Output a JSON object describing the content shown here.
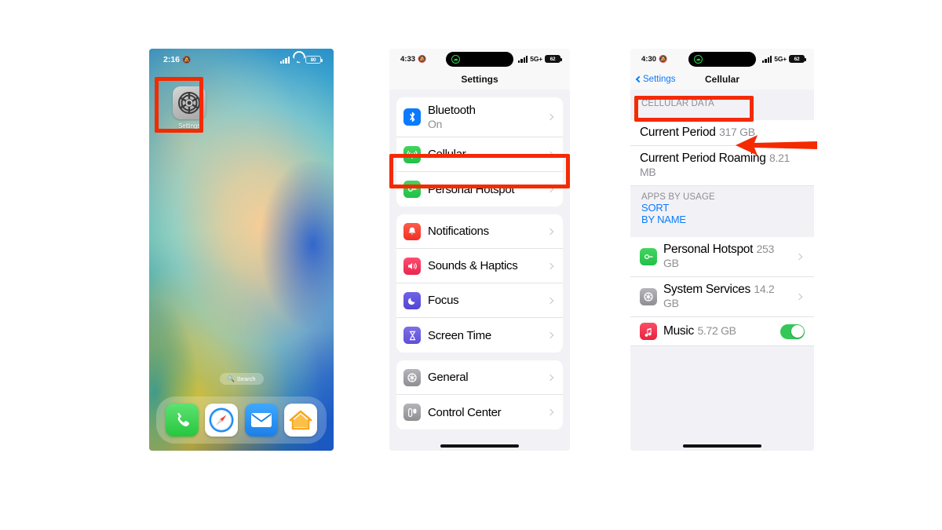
{
  "phone1": {
    "name": "iphone-home-screen",
    "status": {
      "time": "2:16",
      "bell_icon": "bell-slash-icon",
      "signal_icon": "cellular-bars-icon",
      "wifi_icon": "wifi-icon",
      "battery": "80"
    },
    "app": {
      "label": "Settings",
      "icon": "gear-icon"
    },
    "search_pill": {
      "label": "Search",
      "icon": "search-icon"
    },
    "dock": [
      {
        "name": "phone",
        "label": "Phone",
        "icon": "phone-icon"
      },
      {
        "name": "safari",
        "label": "Safari",
        "icon": "compass-icon"
      },
      {
        "name": "mail",
        "label": "Mail",
        "icon": "envelope-icon"
      },
      {
        "name": "home",
        "label": "Home",
        "icon": "house-icon"
      }
    ],
    "highlight": {
      "color": "#f42a00",
      "target": "Settings app icon"
    }
  },
  "phone2": {
    "name": "ios-settings-list",
    "status": {
      "time": "4:33",
      "bell_icon": "bell-slash-icon",
      "island_icon": "facetime-active-icon",
      "signal_icon": "cellular-bars-icon",
      "network": "5G+",
      "battery_icon": "battery-icon"
    },
    "nav_title": "Settings",
    "groups": [
      {
        "rows": [
          {
            "label": "Bluetooth",
            "value": "On",
            "icon": "bluetooth-icon",
            "chevron": true
          },
          {
            "label": "Cellular",
            "value": "",
            "icon": "cellular-antenna-icon",
            "chevron": true
          },
          {
            "label": "Personal Hotspot",
            "value": "",
            "icon": "personal-hotspot-icon",
            "chevron": true
          }
        ]
      },
      {
        "rows": [
          {
            "label": "Notifications",
            "value": "",
            "icon": "notifications-icon",
            "chevron": true
          },
          {
            "label": "Sounds & Haptics",
            "value": "",
            "icon": "speaker-icon",
            "chevron": true
          },
          {
            "label": "Focus",
            "value": "",
            "icon": "moon-icon",
            "chevron": true
          },
          {
            "label": "Screen Time",
            "value": "",
            "icon": "hourglass-icon",
            "chevron": true
          }
        ]
      },
      {
        "rows": [
          {
            "label": "General",
            "value": "",
            "icon": "gear-icon",
            "chevron": true
          },
          {
            "label": "Control Center",
            "value": "",
            "icon": "control-center-icon",
            "chevron": true
          }
        ]
      }
    ],
    "highlight": {
      "color": "#f42a00",
      "target": "Cellular"
    }
  },
  "phone3": {
    "name": "ios-cellular-data-screen",
    "status": {
      "time": "4:30",
      "bell_icon": "bell-slash-icon",
      "island_icon": "facetime-active-icon",
      "signal_icon": "cellular-bars-icon",
      "network": "5G+",
      "battery_icon": "battery-icon"
    },
    "back_label": "Settings",
    "nav_title": "Cellular",
    "section_header": "CELLULAR DATA",
    "usage_rows": [
      {
        "label": "Current Period",
        "value": "317 GB"
      },
      {
        "label": "Current Period Roaming",
        "value": "8.21 MB"
      }
    ],
    "apps_header": "APPS BY USAGE",
    "sort_label": "SORT",
    "sort_value": "BY NAME",
    "app_rows": [
      {
        "label": "Personal Hotspot",
        "value": "253 GB",
        "icon": "personal-hotspot-icon",
        "chevron": true,
        "toggle": null
      },
      {
        "label": "System Services",
        "value": "14.2 GB",
        "icon": "system-services-icon",
        "chevron": true,
        "toggle": null
      },
      {
        "label": "Music",
        "value": "5.72 GB",
        "icon": "music-icon",
        "chevron": false,
        "toggle": "on"
      }
    ],
    "highlight": {
      "color": "#f42a00",
      "target": "CELLULAR DATA"
    },
    "arrow": {
      "color": "#f42a00",
      "points_to": "Current Period",
      "direction": "left"
    }
  }
}
